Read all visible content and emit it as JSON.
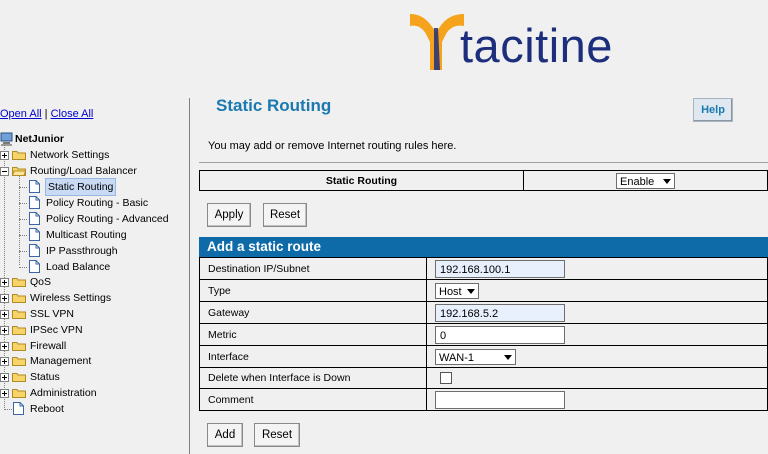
{
  "logo": {
    "text": "tacitine"
  },
  "sidebar": {
    "open_all": "Open All",
    "separator": "|",
    "close_all": "Close All",
    "root": "NetJunior",
    "items": [
      {
        "label": "Network Settings",
        "type": "folder",
        "expanded": false
      },
      {
        "label": "Routing/Load Balancer",
        "type": "folder",
        "expanded": true,
        "children": [
          {
            "label": "Static Routing",
            "selected": true
          },
          {
            "label": "Policy Routing - Basic"
          },
          {
            "label": "Policy Routing - Advanced"
          },
          {
            "label": "Multicast Routing"
          },
          {
            "label": "IP Passthrough"
          },
          {
            "label": "Load Balance"
          }
        ]
      },
      {
        "label": "QoS",
        "type": "folder",
        "expanded": false
      },
      {
        "label": "Wireless Settings",
        "type": "folder",
        "expanded": false
      },
      {
        "label": "SSL VPN",
        "type": "folder",
        "expanded": false
      },
      {
        "label": "IPSec VPN",
        "type": "folder",
        "expanded": false
      },
      {
        "label": "Firewall",
        "type": "folder",
        "expanded": false
      },
      {
        "label": "Management",
        "type": "folder",
        "expanded": false
      },
      {
        "label": "Status",
        "type": "folder",
        "expanded": false
      },
      {
        "label": "Administration",
        "type": "folder",
        "expanded": false
      },
      {
        "label": "Reboot",
        "type": "page"
      }
    ]
  },
  "main": {
    "title": "Static Routing",
    "help": "Help",
    "description": "You may add or remove Internet routing rules here.",
    "status_row": {
      "label": "Static Routing",
      "value": "Enable"
    },
    "apply": "Apply",
    "reset": "Reset"
  },
  "form": {
    "header": "Add a static route",
    "rows": {
      "dest": {
        "label": "Destination IP/Subnet",
        "value": "192.168.100.1"
      },
      "type": {
        "label": "Type",
        "value": "Host"
      },
      "gateway": {
        "label": "Gateway",
        "value": "192.168.5.2"
      },
      "metric": {
        "label": "Metric",
        "value": "0"
      },
      "interface": {
        "label": "Interface",
        "value": "WAN-1"
      },
      "delete_when_down": {
        "label": "Delete when Interface is Down",
        "checked": false
      },
      "comment": {
        "label": "Comment",
        "value": ""
      }
    },
    "add": "Add",
    "reset": "Reset"
  },
  "colors": {
    "accent": "#1a7ab0",
    "header_bar": "#0e6ba8",
    "logo_orange": "#f5a21c",
    "logo_blue": "#1d2f7c"
  }
}
